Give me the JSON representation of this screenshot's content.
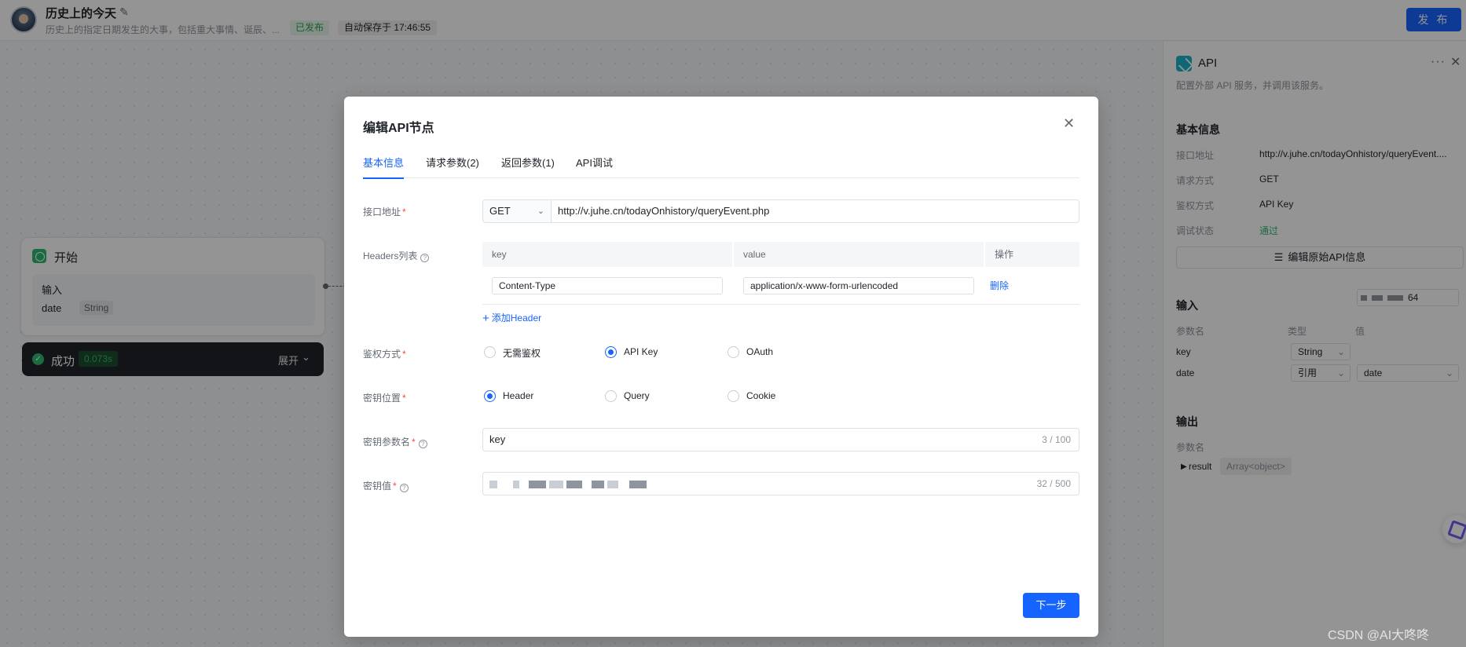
{
  "app": {
    "title": "历史上的今天",
    "description": "历史上的指定日期发生的大事，包括重大事情、诞辰、...",
    "status_badge": "已发布",
    "autosave": "自动保存于 17:46:55",
    "publish_label": "发 布"
  },
  "canvas": {
    "start_node": {
      "title": "开始",
      "input_label": "输入",
      "var_name": "date",
      "var_type": "String"
    },
    "run_result": {
      "status": "成功",
      "duration": "0.073s",
      "expand_label": "展开"
    }
  },
  "right_panel": {
    "title": "API",
    "description": "配置外部 API 服务，并调用该服务。",
    "basic_section": "基本信息",
    "basic_info": [
      {
        "key": "接口地址",
        "value": "http://v.juhe.cn/todayOnhistory/queryEvent...."
      },
      {
        "key": "请求方式",
        "value": "GET"
      },
      {
        "key": "鉴权方式",
        "value": "API Key"
      },
      {
        "key": "调试状态",
        "value": "通过"
      }
    ],
    "edit_button": "编辑原始API信息",
    "input_section": "输入",
    "input_columns": {
      "name": "参数名",
      "type": "类型",
      "value": "值"
    },
    "input_rows": [
      {
        "name": "key",
        "type": "String",
        "value_suffix": "64"
      },
      {
        "name": "date",
        "type": "引用",
        "value": "date"
      }
    ],
    "output_section": "输出",
    "output_column": "参数名",
    "output_rows": [
      {
        "name": "result",
        "type": "Array<object>"
      }
    ]
  },
  "modal": {
    "title": "编辑API节点",
    "tabs": [
      {
        "label": "基本信息",
        "active": true
      },
      {
        "label": "请求参数(2)",
        "active": false
      },
      {
        "label": "返回参数(1)",
        "active": false
      },
      {
        "label": "API调试",
        "active": false
      }
    ],
    "endpoint": {
      "label": "接口地址",
      "method": "GET",
      "url": "http://v.juhe.cn/todayOnhistory/queryEvent.php"
    },
    "headers": {
      "label": "Headers列表",
      "columns": [
        "key",
        "value",
        "操作"
      ],
      "rows": [
        {
          "key": "Content-Type",
          "value": "application/x-www-form-urlencoded",
          "action": "删除"
        }
      ],
      "add_label": "添加Header"
    },
    "auth": {
      "label": "鉴权方式",
      "options": [
        "无需鉴权",
        "API Key",
        "OAuth"
      ],
      "selected": "API Key"
    },
    "key_location": {
      "label": "密钥位置",
      "options": [
        "Header",
        "Query",
        "Cookie"
      ],
      "selected": "Header"
    },
    "key_param": {
      "label": "密钥参数名",
      "value": "key",
      "count": "3 / 100"
    },
    "key_value": {
      "label": "密钥值",
      "count": "32 / 500"
    },
    "next_label": "下一步"
  },
  "watermark": "CSDN @AI大咚咚",
  "colors": {
    "primary": "#1664ff",
    "success": "#2eb872",
    "danger": "#f54a45"
  }
}
